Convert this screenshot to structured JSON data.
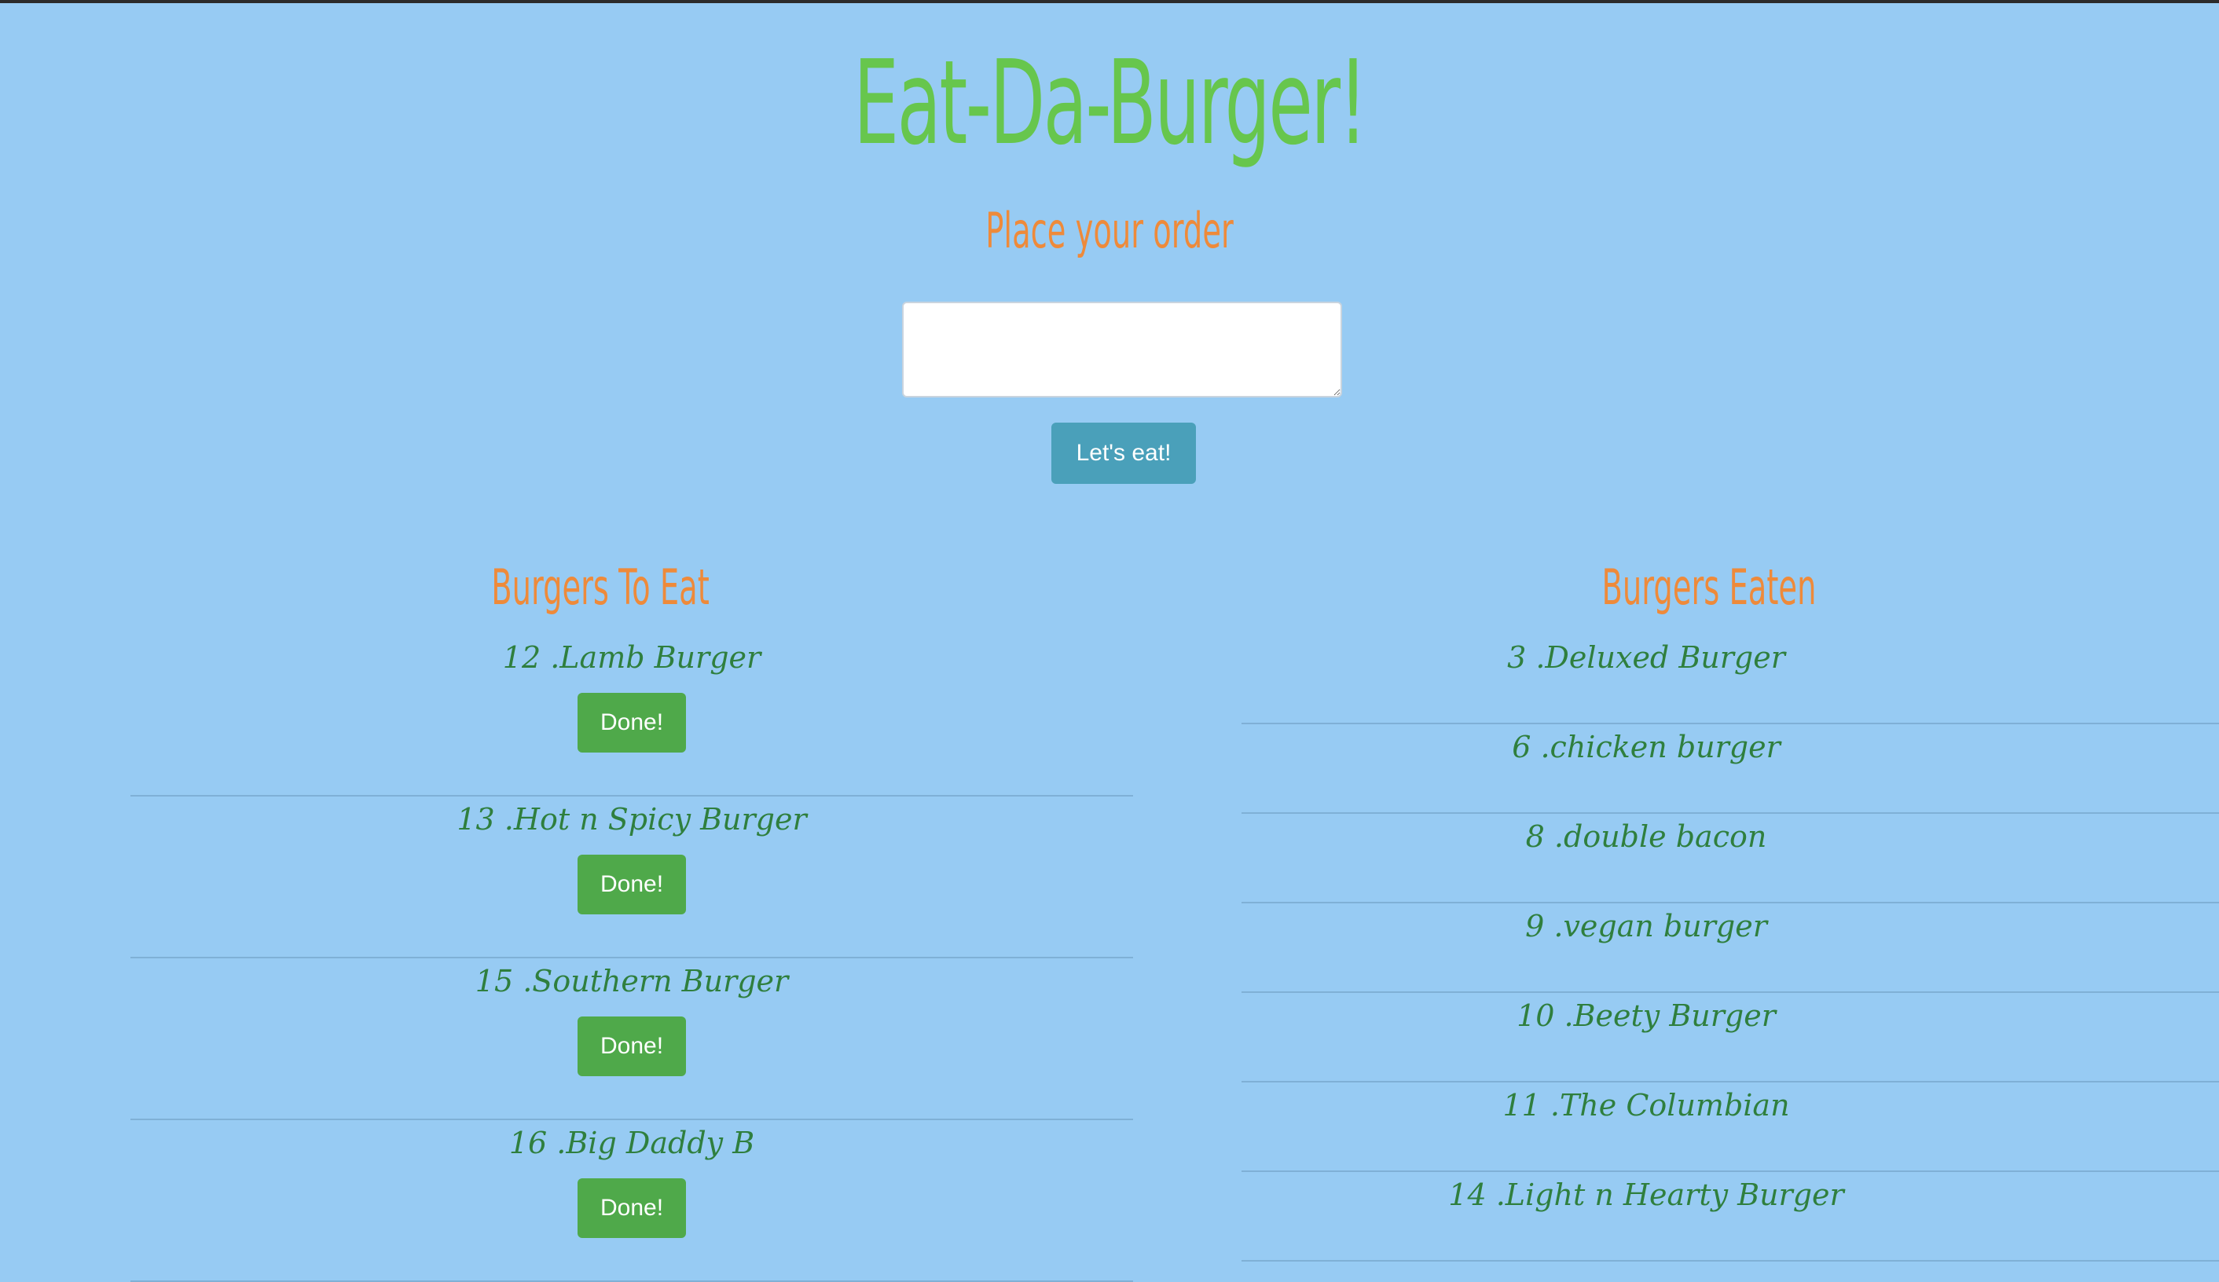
{
  "header": {
    "title": "Eat-Da-Burger!",
    "subtitle": "Place your order"
  },
  "order_form": {
    "input_value": "",
    "submit_label": "Let's eat!"
  },
  "to_eat": {
    "heading": "Burgers To Eat",
    "done_label": "Done!",
    "items": [
      {
        "label": "12 .Lamb Burger"
      },
      {
        "label": "13 .Hot n Spicy Burger"
      },
      {
        "label": "15 .Southern Burger"
      },
      {
        "label": "16 .Big Daddy B"
      }
    ]
  },
  "eaten": {
    "heading": "Burgers Eaten",
    "items": [
      {
        "label": "3 .Deluxed Burger"
      },
      {
        "label": "6 .chicken burger"
      },
      {
        "label": "8 .double bacon"
      },
      {
        "label": "9 .vegan burger"
      },
      {
        "label": "10 .Beety Burger"
      },
      {
        "label": "11 .The Columbian"
      },
      {
        "label": "14 .Light n Hearty Burger"
      }
    ]
  },
  "colors": {
    "background": "#97cbf3",
    "title": "#67c64d",
    "headings": "#ee8a3a",
    "burger_text": "#2f7f3e",
    "done_button": "#4fa94a",
    "submit_button": "#4aa0ba"
  }
}
